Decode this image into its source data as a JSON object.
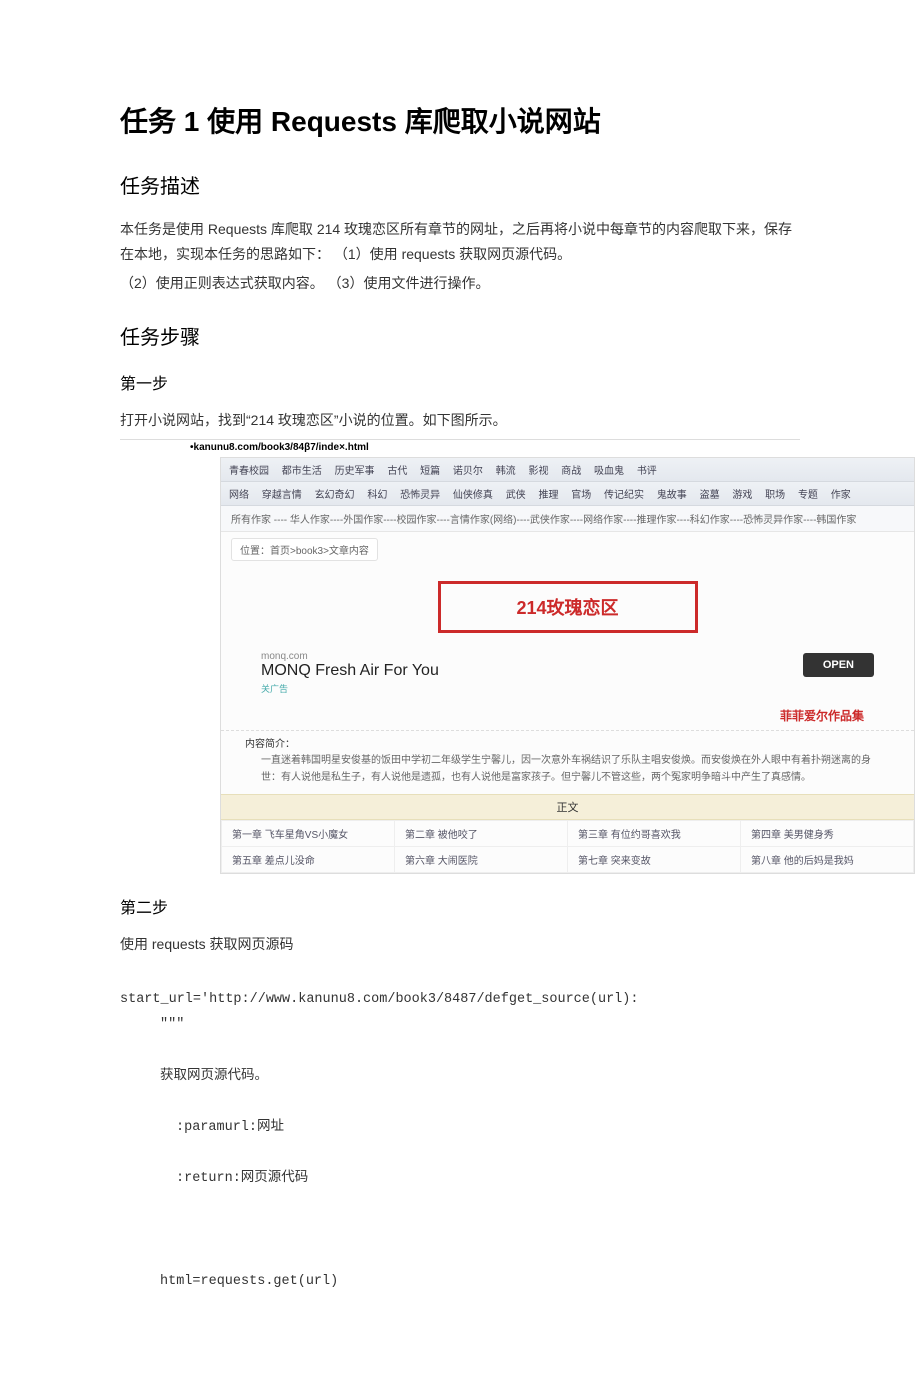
{
  "doc": {
    "h1": "任务 1 使用 Requests 库爬取小说网站",
    "h2a": "任务描述",
    "p1": "本任务是使用 Requests 库爬取 214 玫瑰恋区所有章节的网址，之后再将小说中每章节的内容爬取下来，保存在本地，实现本任务的思路如下： （1）使用 requests 获取网页源代码。",
    "p2": "（2）使用正则表达式获取内容。 （3）使用文件进行操作。",
    "h2b": "任务步骤",
    "h3a": "第一步",
    "p3": "打开小说网站，找到“214 玫瑰恋区”小说的位置。如下图所示。",
    "h3b": "第二步",
    "p4": "使用 requests 获取网页源码",
    "code": {
      "l1": "start_url='http://www.kanunu8.com/book3/8487/defget_source(url):",
      "l2": "\"\"\"",
      "l3": "获取网页源代码。",
      "l4": ":paramurl:网址",
      "l5": ":return:网页源代码",
      "l6": "html=requests.get(url)"
    }
  },
  "shot": {
    "url": "•kanunu8.com/book3/84β7/inde×.html",
    "nav1": [
      "青春校园",
      "都市生活",
      "历史军事",
      "古代",
      "短篇",
      "诺贝尔",
      "韩流",
      "影视",
      "商战",
      "吸血鬼",
      "书评"
    ],
    "nav2": [
      "网络",
      "穿越言情",
      "玄幻奇幻",
      "科幻",
      "恐怖灵异",
      "仙侠修真",
      "武侠",
      "推理",
      "官场",
      "传记纪实",
      "鬼故事",
      "盗墓",
      "游戏",
      "职场",
      "专题",
      "作家"
    ],
    "authors": "所有作家 ---- 华人作家----外国作家----校园作家----言情作家(网络)----武侠作家----网络作家----推理作家----科幻作家----恐怖灵异作家----韩国作家",
    "breadcrumb": "位置：首页>book3>文章内容",
    "title": "214玫瑰恋区",
    "ad": {
      "domain": "monq.com",
      "text": "MONQ Fresh Air For You",
      "close": "关广告",
      "btn": "OPEN"
    },
    "right_label": "菲菲爱尔作品集",
    "intro_hd": "内容简介：",
    "intro_bd": "一直迷着韩国明星安俊基的饭田中学初二年级学生宁馨儿，因一次意外车祸结识了乐队主唱安俊焕。而安俊焕在外人眼中有着扑朔迷离的身世：有人说他是私生子，有人说他是遗孤，也有人说他是富家孩子。但宁馨儿不管这些，两个冤家明争暗斗中产生了真感情。",
    "zw": "正文",
    "chapters": [
      [
        "第一章 飞车星角VS小魔女",
        "第二章 被他咬了",
        "第三章 有位约哥喜欢我",
        "第四章 美男健身秀"
      ],
      [
        "第五章 差点儿没命",
        "第六章 大闹医院",
        "第七章 突来变故",
        "第八章 他的后妈是我妈"
      ]
    ]
  }
}
